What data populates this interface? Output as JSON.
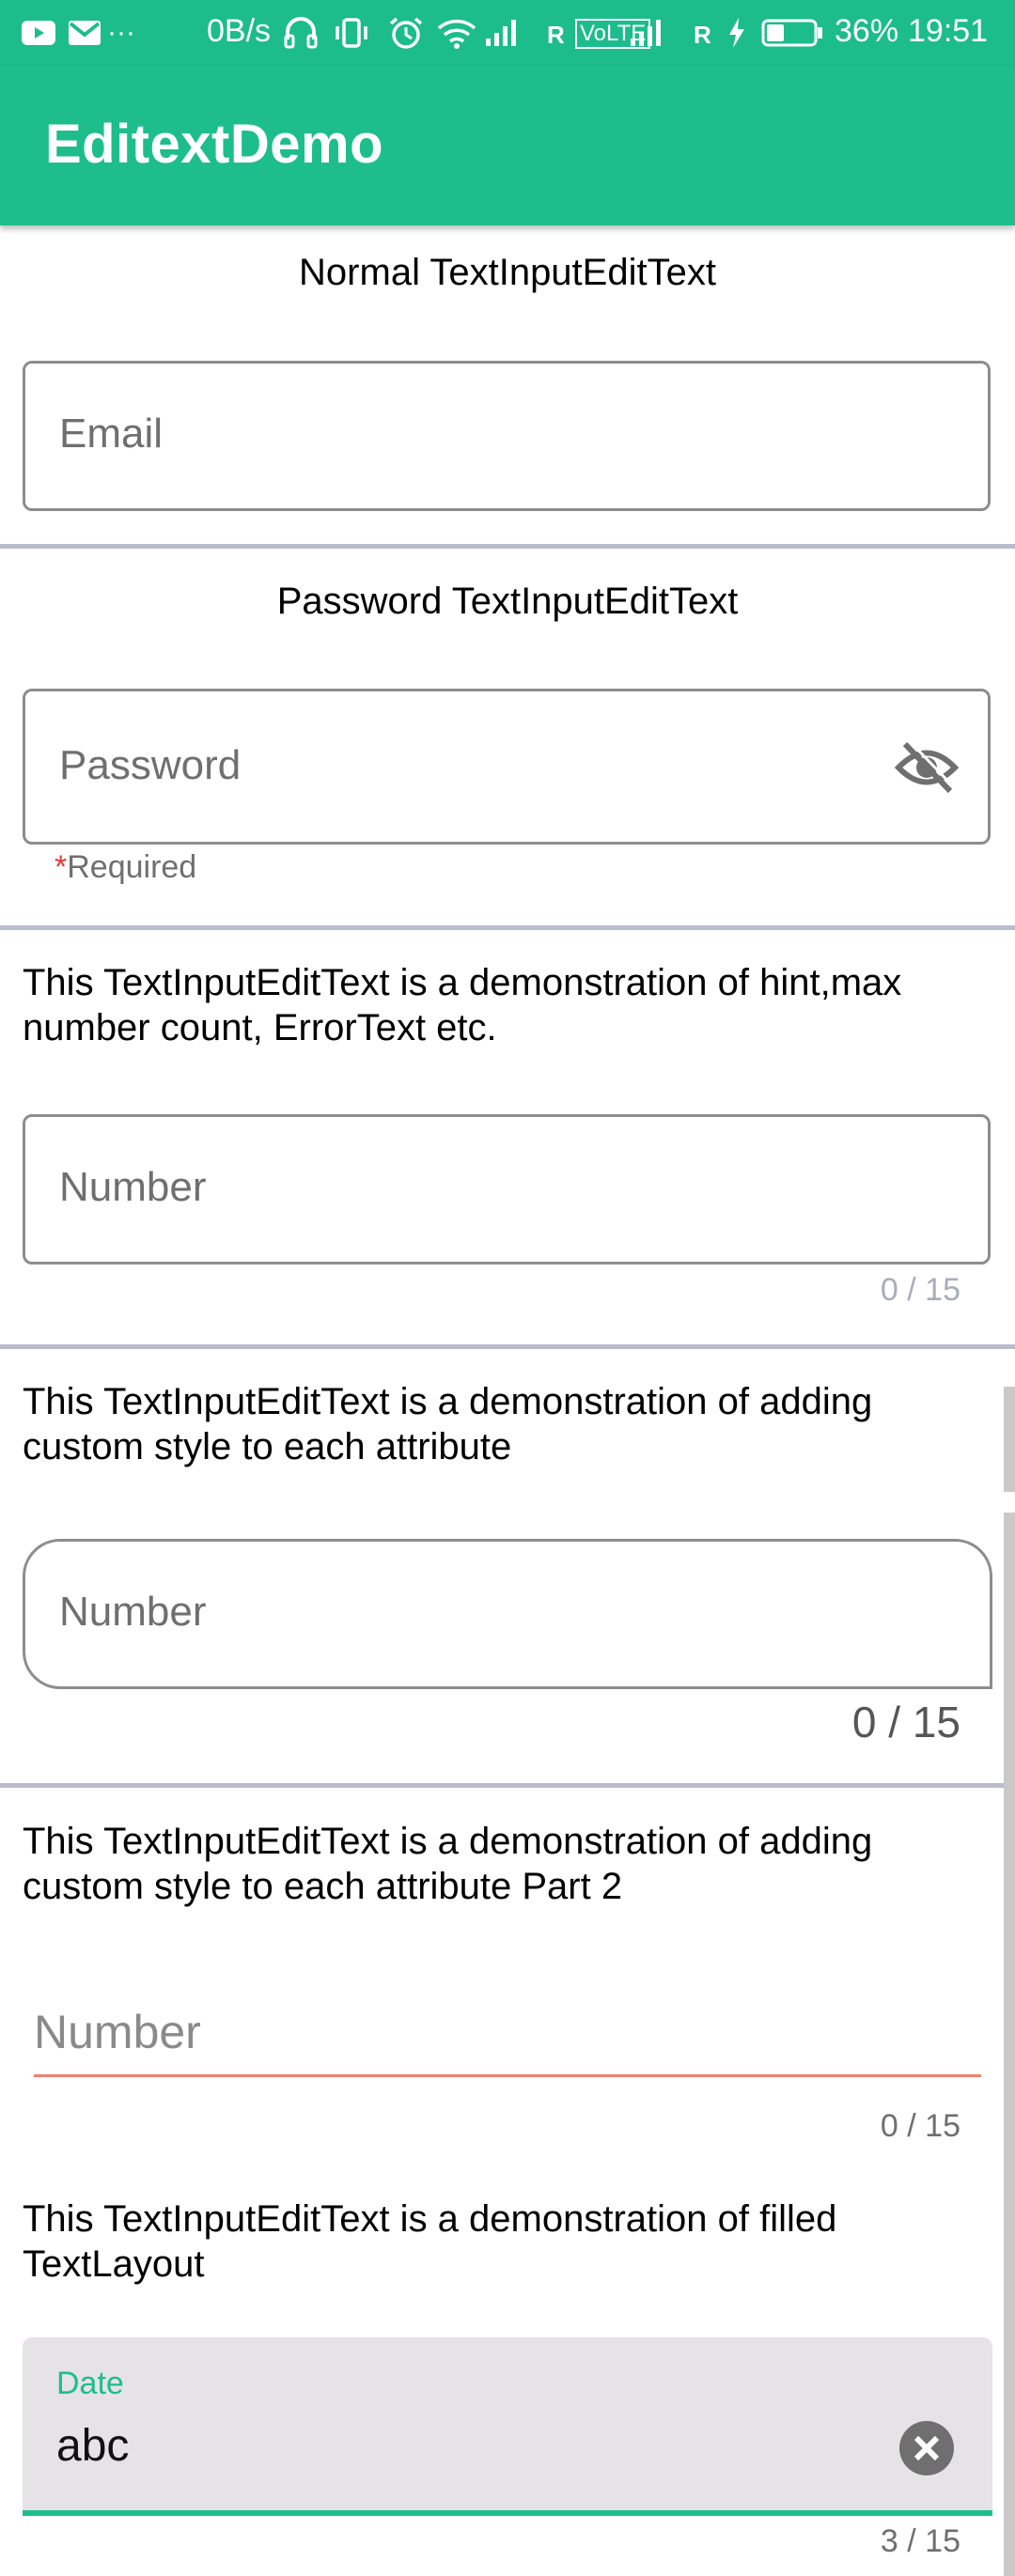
{
  "status_bar": {
    "speed": "0B/s",
    "roaming1": "R",
    "volte": "VoLTE",
    "roaming2": "R",
    "battery": "36%",
    "time": "19:51",
    "icons": [
      "youtube-icon",
      "gmail-icon",
      "more-dots-icon",
      "headphones-icon",
      "vibrate-icon",
      "alarm-icon",
      "wifi-icon",
      "signal-icon",
      "charging-icon",
      "battery-icon"
    ]
  },
  "app_bar": {
    "title": "EditextDemo"
  },
  "section1": {
    "title": "Normal TextInputEditText",
    "hint": "Email"
  },
  "section2": {
    "title": "Password TextInputEditText",
    "hint": "Password",
    "helper_star": "*",
    "helper_text": "Required"
  },
  "section3": {
    "description": "This TextInputEditText is a demonstration of hint,max number count, ErrorText etc.",
    "hint": "Number",
    "counter": "0 / 15"
  },
  "section4": {
    "description": "This TextInputEditText is a demonstration of adding custom style to each attribute",
    "hint": "Number",
    "counter": "0 / 15"
  },
  "section5": {
    "description": "This TextInputEditText is a demonstration of adding custom style to each attribute Part 2",
    "hint": "Number",
    "counter": "0 / 15"
  },
  "section6": {
    "description": "This TextInputEditText is a demonstration of filled TextLayout",
    "label": "Date",
    "value": "abc",
    "counter": "3 / 15"
  },
  "colors": {
    "primary": "#1dbe8c",
    "error_underline": "#f08070",
    "required_star": "#e53935",
    "filled_bg": "#e6e3e6"
  }
}
